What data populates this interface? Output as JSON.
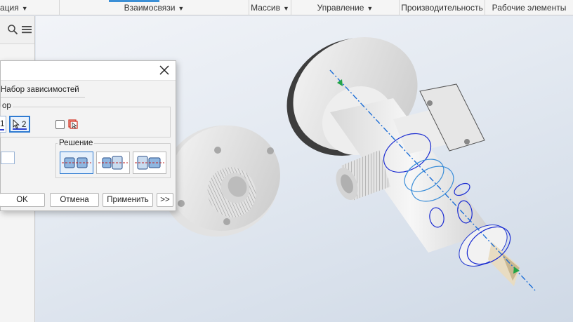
{
  "ribbon": {
    "panels": [
      {
        "label": "ация",
        "dropdown": true
      },
      {
        "label": "Взаимосвязи",
        "dropdown": true
      },
      {
        "label": "Массив",
        "dropdown": true
      },
      {
        "label": "Управление",
        "dropdown": true
      },
      {
        "label": "Производительность",
        "dropdown": false
      },
      {
        "label": "Рабочие элементы",
        "dropdown": false
      }
    ]
  },
  "browser": {
    "icons": [
      "search-icon",
      "menu-icon"
    ]
  },
  "dialog": {
    "tab_label": "Набор зависимостей",
    "selection_group_label": "ор",
    "selection_1_label": "1",
    "selection_2_label": "2",
    "solution_group_label": "Решение",
    "ok_label": "OK",
    "cancel_label": "Отмена",
    "apply_label": "Применить",
    "more_label": ">>"
  },
  "colors": {
    "accent": "#2f7bd1",
    "axis_line": "#1f6fd6",
    "arrow_green": "#23a447",
    "circle_blue": "#1a2bd1"
  }
}
